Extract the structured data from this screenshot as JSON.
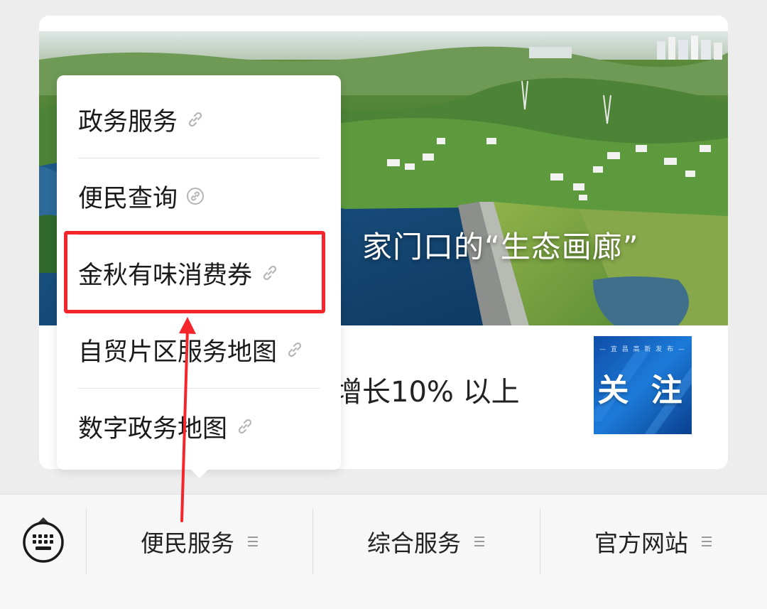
{
  "article": {
    "banner_title": "家门口的“生态画廊”",
    "headline_fragment": "增长10% 以上",
    "thumbnail": {
      "subtitle": "— 宜 昌 高 新 发 布 —",
      "text": "关 注"
    }
  },
  "popup_menu": {
    "items": [
      {
        "label": "政务服务",
        "icon": "link-icon"
      },
      {
        "label": "便民查询",
        "icon": "link-circle-icon"
      },
      {
        "label": "金秋有味消费券",
        "icon": "link-icon"
      },
      {
        "label": "自贸片区服务地图",
        "icon": "link-icon"
      },
      {
        "label": "数字政务地图",
        "icon": "link-icon"
      }
    ],
    "highlighted_index": 2,
    "highlight_color": "#f5262b"
  },
  "bottom_bar": {
    "keyboard_icon": "keyboard-icon",
    "tabs": [
      {
        "label": "便民服务",
        "icon": "menu-lines-icon"
      },
      {
        "label": "综合服务",
        "icon": "menu-lines-icon"
      },
      {
        "label": "官方网站",
        "icon": "menu-lines-icon"
      }
    ]
  },
  "colors": {
    "background": "#ededed",
    "accent_red": "#f5262b"
  }
}
